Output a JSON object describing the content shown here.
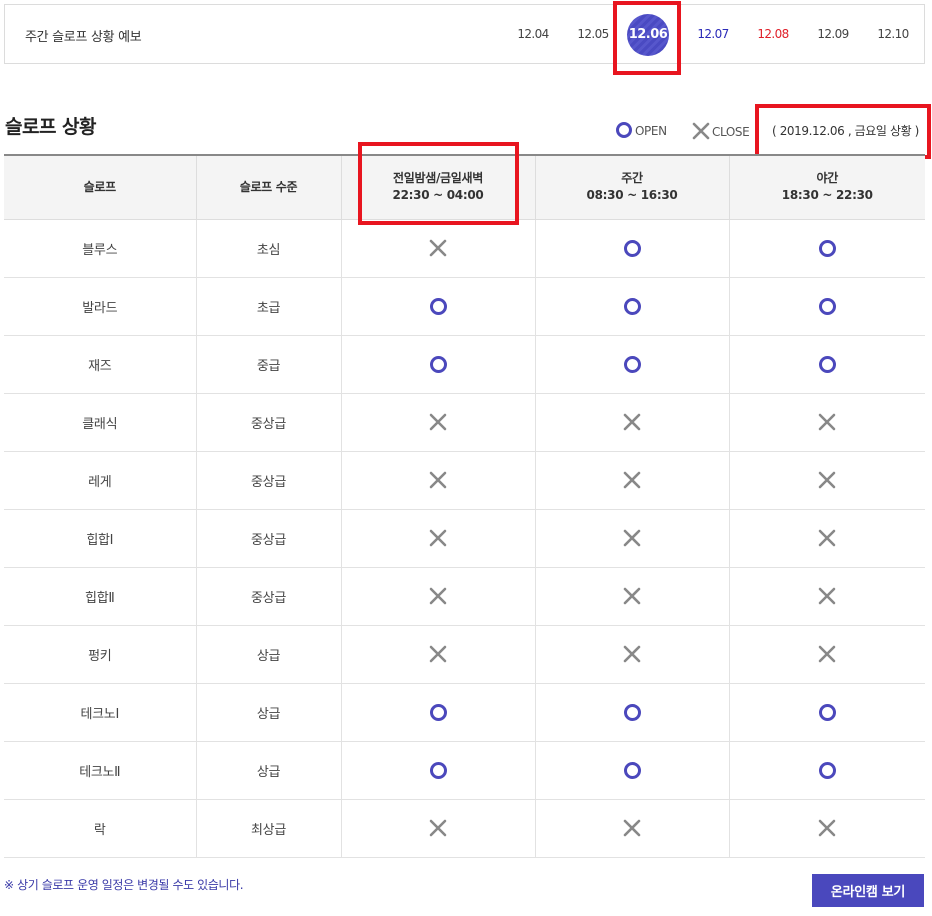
{
  "forecast": {
    "title": "주간 슬로프 상황 예보",
    "dates": [
      {
        "label": "12.04",
        "state": "normal"
      },
      {
        "label": "12.05",
        "state": "normal"
      },
      {
        "label": "12.06",
        "state": "selected"
      },
      {
        "label": "12.07",
        "state": "saturday"
      },
      {
        "label": "12.08",
        "state": "sunday"
      },
      {
        "label": "12.09",
        "state": "normal"
      },
      {
        "label": "12.10",
        "state": "normal"
      }
    ]
  },
  "section": {
    "title": "슬로프 상황",
    "legend_open": "OPEN",
    "legend_close": "CLOSE",
    "date_status": "( 2019.12.06 , 금요일 상황 )"
  },
  "table": {
    "headers": [
      {
        "line1": "슬로프",
        "line2": ""
      },
      {
        "line1": "슬로프 수준",
        "line2": ""
      },
      {
        "line1": "전일밤샘/금일새벽",
        "line2": "22:30 ~ 04:00"
      },
      {
        "line1": "주간",
        "line2": "08:30 ~ 16:30"
      },
      {
        "line1": "야간",
        "line2": "18:30 ~ 22:30"
      }
    ],
    "rows": [
      {
        "name": "블루스",
        "level": "초심",
        "status": [
          "close",
          "open",
          "open"
        ]
      },
      {
        "name": "발라드",
        "level": "초급",
        "status": [
          "open",
          "open",
          "open"
        ]
      },
      {
        "name": "재즈",
        "level": "중급",
        "status": [
          "open",
          "open",
          "open"
        ]
      },
      {
        "name": "클래식",
        "level": "중상급",
        "status": [
          "close",
          "close",
          "close"
        ]
      },
      {
        "name": "레게",
        "level": "중상급",
        "status": [
          "close",
          "close",
          "close"
        ]
      },
      {
        "name": "힙합Ⅰ",
        "level": "중상급",
        "status": [
          "close",
          "close",
          "close"
        ]
      },
      {
        "name": "힙합Ⅱ",
        "level": "중상급",
        "status": [
          "close",
          "close",
          "close"
        ]
      },
      {
        "name": "펑키",
        "level": "상급",
        "status": [
          "close",
          "close",
          "close"
        ]
      },
      {
        "name": "테크노Ⅰ",
        "level": "상급",
        "status": [
          "open",
          "open",
          "open"
        ]
      },
      {
        "name": "테크노Ⅱ",
        "level": "상급",
        "status": [
          "open",
          "open",
          "open"
        ]
      },
      {
        "name": "락",
        "level": "최상급",
        "status": [
          "close",
          "close",
          "close"
        ]
      }
    ]
  },
  "footer": {
    "notice": "※ 상기 슬로프 운영 일정은 변경될 수도 있습니다.",
    "webcam_button": "온라인캠 보기"
  },
  "colors": {
    "accent": "#4b48bc",
    "highlight": "#e8151f",
    "saturday": "#2b2bb8",
    "sunday": "#e0202a",
    "close_mark": "#888888"
  }
}
